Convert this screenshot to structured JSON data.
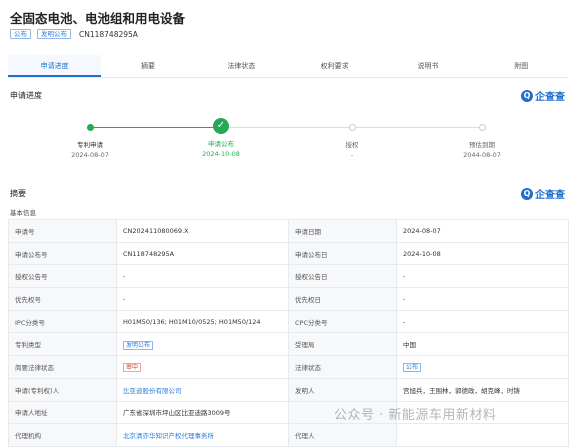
{
  "header": {
    "title": "全固态电池、电池组和用电设备",
    "badge_status": "公布",
    "badge_type": "发明公布",
    "pub_number": "CN118748295A"
  },
  "tabs": [
    "申请进度",
    "摘要",
    "法律状态",
    "权利要求",
    "说明书",
    "附图"
  ],
  "progress": {
    "title": "申请进度",
    "logo": "企查查",
    "steps": [
      {
        "label": "专利申请",
        "date": "2024-08-07"
      },
      {
        "label": "申请公布",
        "date": "2024-10-08"
      },
      {
        "label": "授权",
        "date": "-"
      },
      {
        "label": "预估到期",
        "date": "2044-08-07"
      }
    ]
  },
  "abstract": {
    "title": "摘要",
    "logo": "企查查",
    "basic_title": "基本信息"
  },
  "info": {
    "rows": [
      [
        "申请号",
        "CN202411080069.X",
        "申请日期",
        "2024-08-07"
      ],
      [
        "申请公布号",
        "CN118748295A",
        "申请公布日",
        "2024-10-08"
      ],
      [
        "授权公告号",
        "-",
        "授权公告日",
        "-"
      ],
      [
        "优先权号",
        "-",
        "优先权日",
        "-"
      ],
      [
        "IPC分类号",
        "H01M50/136; H01M10/0525; H01M50/124",
        "CPC分类号",
        "-"
      ],
      [
        "专利类型",
        "发明公布",
        "受理局",
        "中国"
      ],
      [
        "简要法律状态",
        "审中",
        "法律状态",
        "公布"
      ],
      [
        "申请(专利权)人",
        "比亚迪股份有限公司",
        "发明人",
        "宫旭兵，王围林，郭德政，胡克峰，时铸"
      ],
      [
        "申请人地址",
        "广东省深圳市坪山区比亚迪路3009号",
        "",
        ""
      ],
      [
        "代理机构",
        "北京清亦华知识产权代理事务所",
        "代理人",
        ""
      ]
    ]
  },
  "watermark": "公众号 · 新能源车用新材料"
}
